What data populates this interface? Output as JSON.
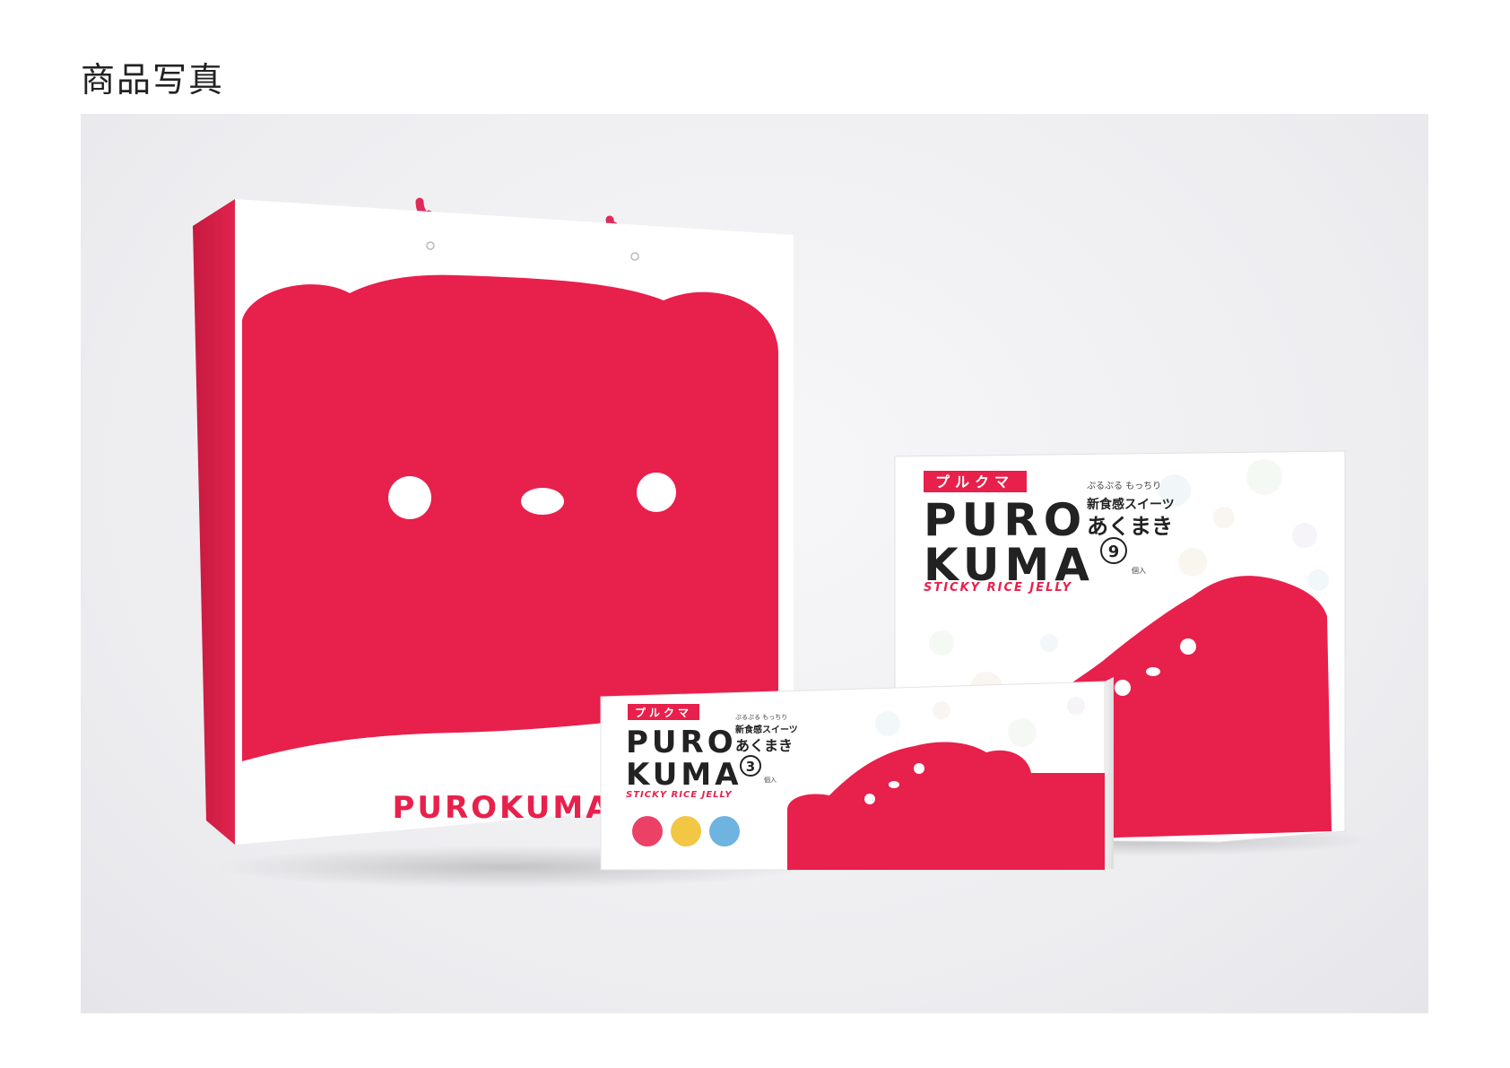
{
  "page": {
    "title": "商品写真"
  },
  "photo": {
    "bag": {
      "logo_text": "PUROKUMA",
      "color_main": "#e8204c",
      "color_paper": "#ffffff"
    },
    "large_box": {
      "katakana": "プルクマ",
      "logo_line1": "PURO",
      "logo_line2": "KUMA",
      "tagline_small": "ぷるぷる もっちり",
      "tagline_1": "新食感スイーツ",
      "tagline_2": "あくまき",
      "count": "9",
      "count_unit": "個入",
      "subtitle": "STICKY RICE JELLY"
    },
    "small_box": {
      "katakana": "プルクマ",
      "logo_line1": "PURO",
      "logo_line2": "KUMA",
      "tagline_small": "ぷるぷる もっちり",
      "tagline_1": "新食感スイーツ",
      "tagline_2": "あくまき",
      "count": "3",
      "count_unit": "個入",
      "subtitle": "STICKY RICE JELLY"
    }
  }
}
